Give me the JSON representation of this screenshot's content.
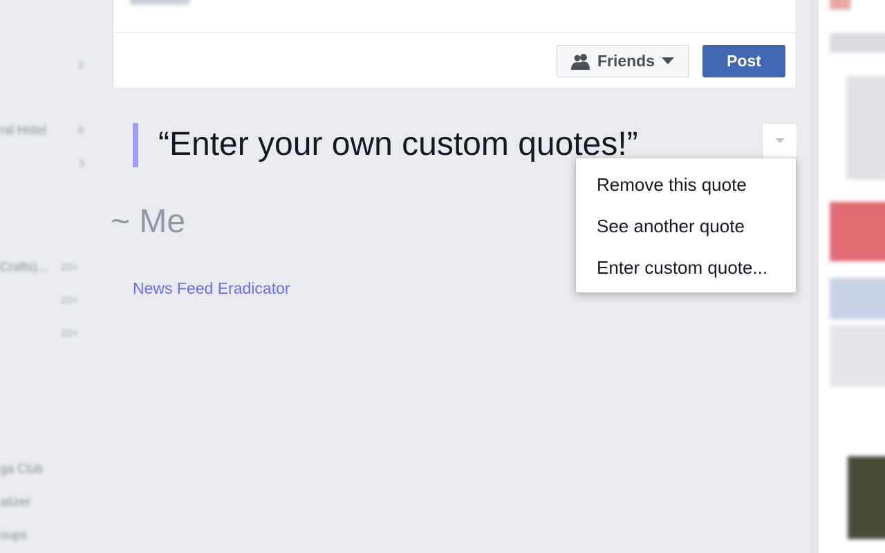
{
  "composer": {
    "audience_label": "Friends",
    "audience_icon": "friends-icon",
    "post_label": "Post"
  },
  "quote": {
    "text": "“Enter your own custom quotes!”",
    "author": "~ Me"
  },
  "credit_link": "News Feed Eradicator",
  "quote_menu": {
    "toggle_icon": "caret-down-icon",
    "items": [
      {
        "label": "Remove this quote"
      },
      {
        "label": "See another quote"
      },
      {
        "label": "Enter custom quote..."
      }
    ]
  },
  "colors": {
    "page_background": "#e9ebee",
    "primary_button": "#4267b2",
    "quote_bar": "#9d9dfe",
    "link": "#6b6bfc"
  }
}
